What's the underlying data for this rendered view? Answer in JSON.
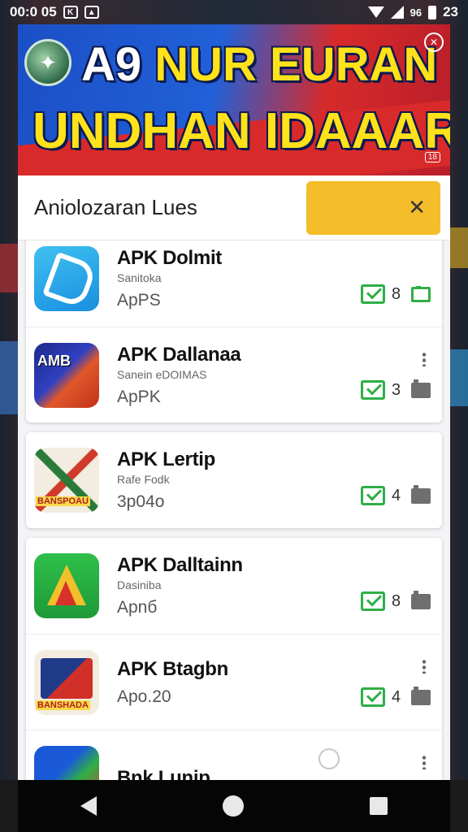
{
  "status_bar": {
    "time": "00:0 05",
    "battery": "96",
    "battery_level": "23"
  },
  "banner": {
    "line1_prefix": "A9",
    "line1_rest": "NUR EURAN",
    "line2": "UNDHAN IDAAAR!",
    "badge": "18"
  },
  "search": {
    "value": "Aniolozaran Lues",
    "clear_label": "✕"
  },
  "apps": [
    {
      "title": "APK Dolmit",
      "subtitle": "Sanitoka",
      "meta": "ApPS",
      "count": "8"
    },
    {
      "title": "APK Dallanaa",
      "subtitle": "Sanein eDOIMAS",
      "meta": "ApPK",
      "count": "3",
      "icon_label": "AMB"
    },
    {
      "title": "APK Lertip",
      "subtitle": "Rafe Fodk",
      "meta": "3p04o",
      "count": "4",
      "icon_label": "BANSPOAU"
    },
    {
      "title": "APK Dalltainn",
      "subtitle": "Dasiniba",
      "meta": "Apnб",
      "count": "8"
    },
    {
      "title": "APK Btagbn",
      "subtitle": "",
      "meta": "Apo.20",
      "count": "4",
      "icon_label": "BANSHADA"
    },
    {
      "title": "Bnk Lunip",
      "subtitle": "",
      "meta": "",
      "count": ""
    }
  ],
  "nav": {
    "back": "back",
    "home": "home",
    "recent": "recent"
  },
  "colors": {
    "accent": "#f4bd2a",
    "check_green": "#2fae46",
    "banner_blue": "#1c4fc6",
    "banner_red": "#d72a2a"
  }
}
